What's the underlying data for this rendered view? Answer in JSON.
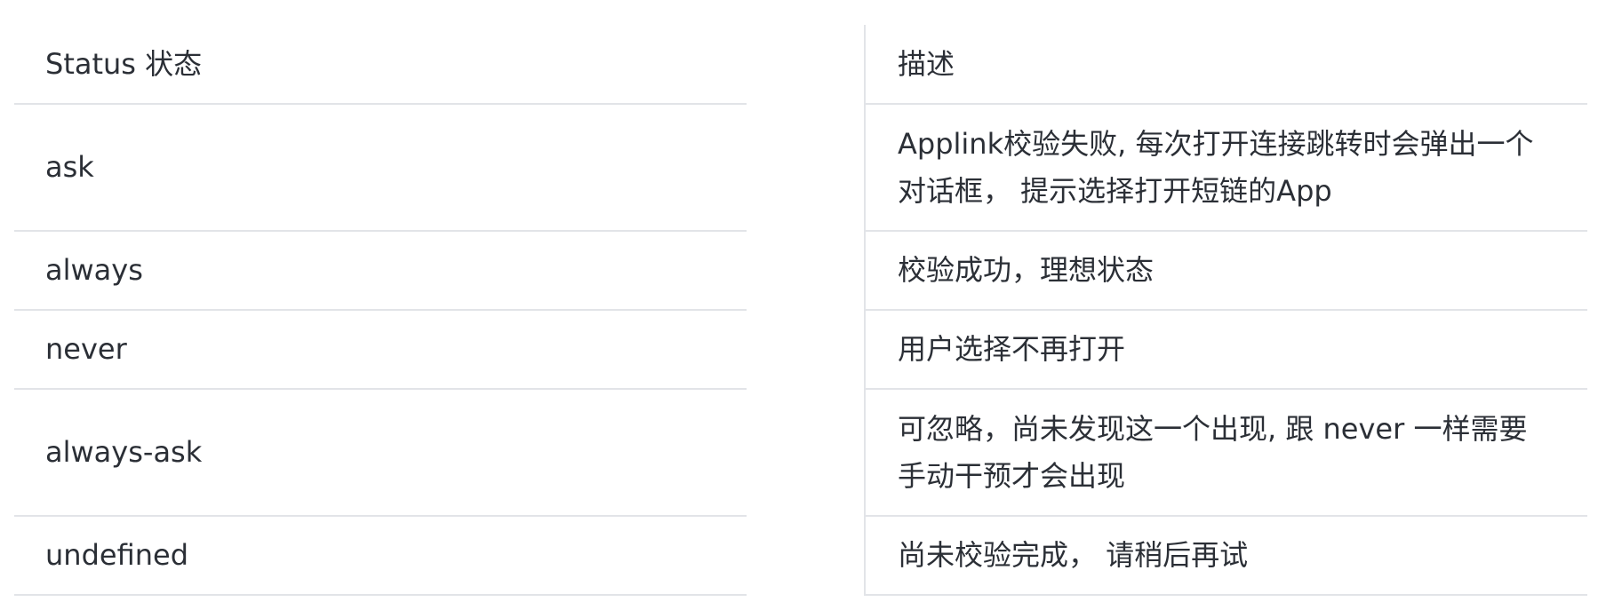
{
  "table": {
    "header": {
      "status": "Status 状态",
      "description": "描述"
    },
    "rows": [
      {
        "status": "ask",
        "description": "Applink校验失败, 每次打开连接跳转时会弹出一个对话框， 提示选择打开短链的App"
      },
      {
        "status": "always",
        "description": "校验成功，理想状态"
      },
      {
        "status": "never",
        "description": "用户选择不再打开"
      },
      {
        "status": "always-ask",
        "description": "可忽略，尚未发现这一个出现, 跟 never 一样需要手动干预才会出现"
      },
      {
        "status": "undefined",
        "description": "尚未校验完成， 请稍后再试"
      }
    ]
  }
}
